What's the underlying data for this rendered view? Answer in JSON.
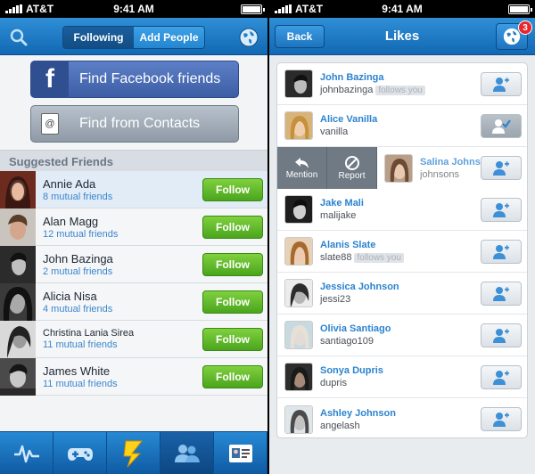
{
  "status": {
    "carrier": "AT&T",
    "time": "9:41 AM"
  },
  "left": {
    "segments": {
      "following": "Following",
      "add_people": "Add People"
    },
    "facebook_button": "Find Facebook friends",
    "facebook_logo": "f",
    "contacts_button": "Find from Contacts",
    "contacts_card": "@",
    "section_title": "Suggested Friends",
    "follow_label": "Follow",
    "suggestions": [
      {
        "name": "Annie Ada",
        "mutual": "8 mutual friends"
      },
      {
        "name": "Alan Magg",
        "mutual": "12 mutual friends"
      },
      {
        "name": "John Bazinga",
        "mutual": "2 mutual friends"
      },
      {
        "name": "Alicia Nisa",
        "mutual": "4 mutual friends"
      },
      {
        "name": "Christina Lania Sirea",
        "mutual": "11 mutual friends"
      },
      {
        "name": "James White",
        "mutual": "11 mutual friends"
      }
    ],
    "tabs": [
      "activity-icon",
      "gamepad-icon",
      "zap-icon",
      "people-icon",
      "contact-card-icon"
    ]
  },
  "right": {
    "title": "Likes",
    "back_label": "Back",
    "badge_count": "3",
    "follows_you": "follows you",
    "swipe": {
      "mention": "Mention",
      "report": "Report"
    },
    "likes": [
      {
        "name": "John Bazinga",
        "user": "johnbazinga",
        "follows_you": true,
        "state": "add"
      },
      {
        "name": "Alice Vanilla",
        "user": "vanilla",
        "follows_you": false,
        "state": "checked"
      },
      {
        "name": "Salina Johnsons",
        "user": "johnsons",
        "follows_you": false,
        "state": "add"
      },
      {
        "name": "Jake Mali",
        "user": "malijake",
        "follows_you": false,
        "state": "add"
      },
      {
        "name": "Alanis Slate",
        "user": "slate88",
        "follows_you": true,
        "state": "add"
      },
      {
        "name": "Jessica Johnson",
        "user": "jessi23",
        "follows_you": false,
        "state": "add"
      },
      {
        "name": "Olivia Santiago",
        "user": "santiago109",
        "follows_you": false,
        "state": "add"
      },
      {
        "name": "Sonya Dupris",
        "user": "dupris",
        "follows_you": false,
        "state": "add"
      },
      {
        "name": "Ashley Johnson",
        "user": "angelash",
        "follows_you": false,
        "state": "add"
      }
    ]
  },
  "colors": {
    "brand_blue": "#1c74c0",
    "follow_green": "#5cb82a",
    "link_blue": "#2b83cf",
    "badge_red": "#e8262b"
  }
}
